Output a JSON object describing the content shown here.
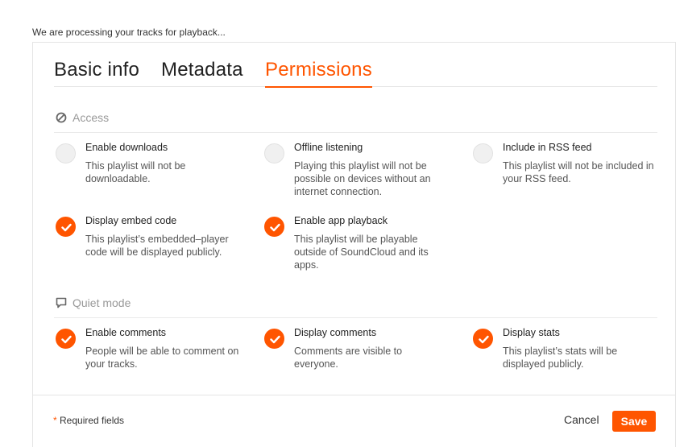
{
  "status_text": "We are processing your tracks for playback...",
  "tabs": [
    {
      "label": "Basic info",
      "active": false
    },
    {
      "label": "Metadata",
      "active": false
    },
    {
      "label": "Permissions",
      "active": true
    }
  ],
  "access": {
    "header": "Access",
    "icon": "no-entry-icon",
    "options": [
      {
        "label": "Enable downloads",
        "desc": "This playlist will not be downloadable.",
        "checked": false
      },
      {
        "label": "Offline listening",
        "desc": "Playing this playlist will not be possible on devices without an internet connection.",
        "checked": false
      },
      {
        "label": "Include in RSS feed",
        "desc": "This playlist will not be included in your RSS feed.",
        "checked": false
      },
      {
        "label": "Display embed code",
        "desc": "This playlist’s embedded–player code will be displayed publicly.",
        "checked": true
      },
      {
        "label": "Enable app playback",
        "desc": "This playlist will be playable outside of SoundCloud and its apps.",
        "checked": true
      }
    ]
  },
  "quiet_mode": {
    "header": "Quiet mode",
    "icon": "speech-bubble-icon",
    "options": [
      {
        "label": "Enable comments",
        "desc": "People will be able to comment on your tracks.",
        "checked": true
      },
      {
        "label": "Display comments",
        "desc": "Comments are visible to everyone.",
        "checked": true
      },
      {
        "label": "Display stats",
        "desc": "This playlist’s stats will be displayed publicly.",
        "checked": true
      }
    ]
  },
  "footer": {
    "required_star": "*",
    "required_text": "Required fields",
    "cancel_label": "Cancel",
    "save_label": "Save"
  },
  "colors": {
    "accent": "#ff5500",
    "unchecked": "#f0f0f0",
    "muted": "#999999"
  }
}
